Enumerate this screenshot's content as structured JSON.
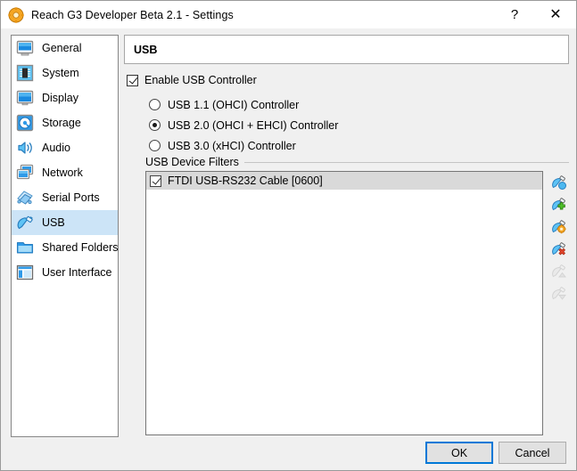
{
  "window": {
    "title": "Reach G3 Developer Beta 2.1 - Settings",
    "icon": "settings-gear-icon",
    "help_label": "?",
    "close_label": "✕"
  },
  "sidebar": {
    "items": [
      {
        "label": "General",
        "icon": "monitor-icon",
        "selected": false
      },
      {
        "label": "System",
        "icon": "chip-icon",
        "selected": false
      },
      {
        "label": "Display",
        "icon": "display-icon",
        "selected": false
      },
      {
        "label": "Storage",
        "icon": "harddisk-icon",
        "selected": false
      },
      {
        "label": "Audio",
        "icon": "speaker-icon",
        "selected": false
      },
      {
        "label": "Network",
        "icon": "network-cards-icon",
        "selected": false
      },
      {
        "label": "Serial Ports",
        "icon": "serial-port-icon",
        "selected": false
      },
      {
        "label": "USB",
        "icon": "usb-plug-icon",
        "selected": true
      },
      {
        "label": "Shared Folders",
        "icon": "folder-icon",
        "selected": false
      },
      {
        "label": "User Interface",
        "icon": "window-layout-icon",
        "selected": false
      }
    ]
  },
  "page": {
    "header": "USB",
    "enable_controller": {
      "label": "Enable USB Controller",
      "checked": true
    },
    "controller_options": [
      {
        "label": "USB 1.1 (OHCI) Controller",
        "selected": false
      },
      {
        "label": "USB 2.0 (OHCI + EHCI) Controller",
        "selected": true
      },
      {
        "label": "USB 3.0 (xHCI) Controller",
        "selected": false
      }
    ],
    "filters_group_title": "USB Device Filters",
    "filters": [
      {
        "label": "FTDI USB-RS232 Cable [0600]",
        "checked": true,
        "selected": true
      }
    ],
    "filter_actions": [
      {
        "name": "add-filter-from-device-icon",
        "enabled": true
      },
      {
        "name": "add-new-filter-icon",
        "enabled": true
      },
      {
        "name": "edit-filter-icon",
        "enabled": true
      },
      {
        "name": "remove-filter-icon",
        "enabled": true
      },
      {
        "name": "move-filter-up-icon",
        "enabled": false
      },
      {
        "name": "move-filter-down-icon",
        "enabled": false
      }
    ]
  },
  "footer": {
    "ok_label": "OK",
    "cancel_label": "Cancel"
  },
  "colors": {
    "accent": "#0078d7",
    "selection": "#cce4f7",
    "window_bg": "#f0f0f0",
    "list_row_selected": "#d9d9d9"
  }
}
